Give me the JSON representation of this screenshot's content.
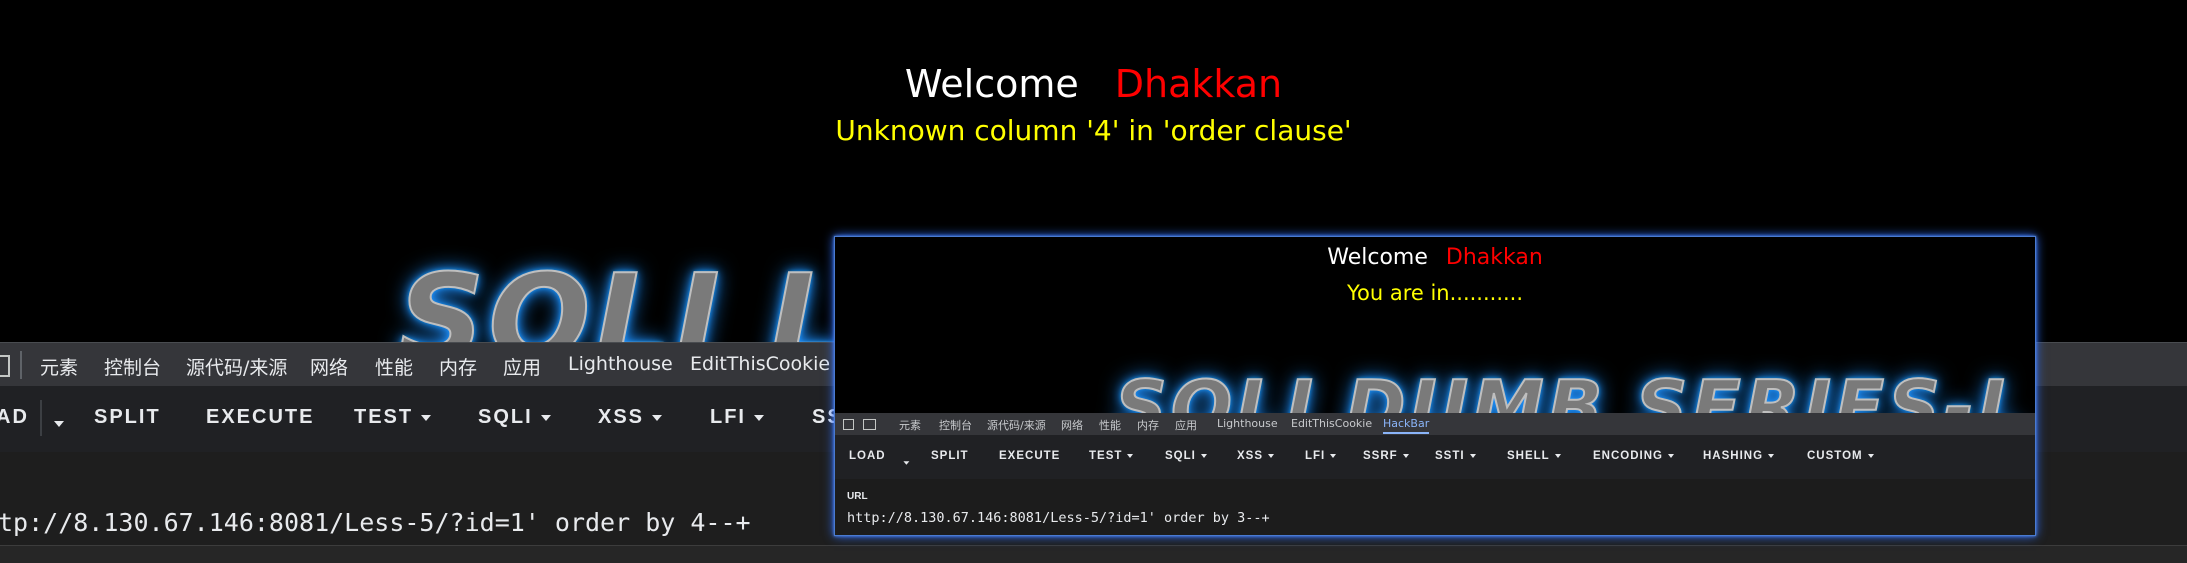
{
  "page": {
    "welcome_label": "Welcome",
    "user_name": "Dhakkan",
    "message": "Unknown column '4' in 'order clause'",
    "banner_partial": "SQLI L"
  },
  "devtools": {
    "tabs": [
      "元素",
      "控制台",
      "源代码/来源",
      "网络",
      "性能",
      "内存",
      "应用",
      "Lighthouse",
      "EditThisCookie"
    ],
    "toolbar": [
      "AD",
      "SPLIT",
      "EXECUTE",
      "TEST",
      "SQLI",
      "XSS",
      "LFI",
      "SS"
    ],
    "url_value": "tp://8.130.67.146:8081/Less-5/?id=1' order by 4--+"
  },
  "inset": {
    "welcome_label": "Welcome",
    "user_name": "Dhakkan",
    "message": "You are in...........",
    "banner_text": "SQLI DUMB SERIES-L",
    "tabs": [
      "元素",
      "控制台",
      "源代码/来源",
      "网络",
      "性能",
      "内存",
      "应用",
      "Lighthouse",
      "EditThisCookie",
      "HackBar"
    ],
    "toolbar": [
      "LOAD",
      "SPLIT",
      "EXECUTE",
      "TEST",
      "SQLI",
      "XSS",
      "LFI",
      "SSRF",
      "SSTI",
      "SHELL",
      "ENCODING",
      "HASHING",
      "CUSTOM"
    ],
    "url_label": "URL",
    "url_value": "http://8.130.67.146:8081/Less-5/?id=1' order by 3--+"
  },
  "colors": {
    "background": "#000000",
    "welcome": "#ffffff",
    "user_name": "#ff0000",
    "message": "#ffff00",
    "devtools_bg": "#292a2d",
    "banner_glow": "#1e90ff"
  }
}
